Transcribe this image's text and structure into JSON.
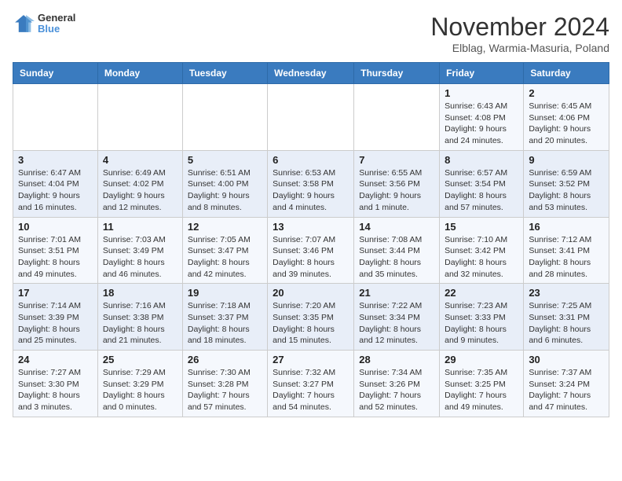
{
  "header": {
    "logo_text_1": "General",
    "logo_text_2": "Blue",
    "month": "November 2024",
    "location": "Elblag, Warmia-Masuria, Poland"
  },
  "days_of_week": [
    "Sunday",
    "Monday",
    "Tuesday",
    "Wednesday",
    "Thursday",
    "Friday",
    "Saturday"
  ],
  "weeks": [
    [
      {
        "day": "",
        "info": ""
      },
      {
        "day": "",
        "info": ""
      },
      {
        "day": "",
        "info": ""
      },
      {
        "day": "",
        "info": ""
      },
      {
        "day": "",
        "info": ""
      },
      {
        "day": "1",
        "info": "Sunrise: 6:43 AM\nSunset: 4:08 PM\nDaylight: 9 hours and 24 minutes."
      },
      {
        "day": "2",
        "info": "Sunrise: 6:45 AM\nSunset: 4:06 PM\nDaylight: 9 hours and 20 minutes."
      }
    ],
    [
      {
        "day": "3",
        "info": "Sunrise: 6:47 AM\nSunset: 4:04 PM\nDaylight: 9 hours and 16 minutes."
      },
      {
        "day": "4",
        "info": "Sunrise: 6:49 AM\nSunset: 4:02 PM\nDaylight: 9 hours and 12 minutes."
      },
      {
        "day": "5",
        "info": "Sunrise: 6:51 AM\nSunset: 4:00 PM\nDaylight: 9 hours and 8 minutes."
      },
      {
        "day": "6",
        "info": "Sunrise: 6:53 AM\nSunset: 3:58 PM\nDaylight: 9 hours and 4 minutes."
      },
      {
        "day": "7",
        "info": "Sunrise: 6:55 AM\nSunset: 3:56 PM\nDaylight: 9 hours and 1 minute."
      },
      {
        "day": "8",
        "info": "Sunrise: 6:57 AM\nSunset: 3:54 PM\nDaylight: 8 hours and 57 minutes."
      },
      {
        "day": "9",
        "info": "Sunrise: 6:59 AM\nSunset: 3:52 PM\nDaylight: 8 hours and 53 minutes."
      }
    ],
    [
      {
        "day": "10",
        "info": "Sunrise: 7:01 AM\nSunset: 3:51 PM\nDaylight: 8 hours and 49 minutes."
      },
      {
        "day": "11",
        "info": "Sunrise: 7:03 AM\nSunset: 3:49 PM\nDaylight: 8 hours and 46 minutes."
      },
      {
        "day": "12",
        "info": "Sunrise: 7:05 AM\nSunset: 3:47 PM\nDaylight: 8 hours and 42 minutes."
      },
      {
        "day": "13",
        "info": "Sunrise: 7:07 AM\nSunset: 3:46 PM\nDaylight: 8 hours and 39 minutes."
      },
      {
        "day": "14",
        "info": "Sunrise: 7:08 AM\nSunset: 3:44 PM\nDaylight: 8 hours and 35 minutes."
      },
      {
        "day": "15",
        "info": "Sunrise: 7:10 AM\nSunset: 3:42 PM\nDaylight: 8 hours and 32 minutes."
      },
      {
        "day": "16",
        "info": "Sunrise: 7:12 AM\nSunset: 3:41 PM\nDaylight: 8 hours and 28 minutes."
      }
    ],
    [
      {
        "day": "17",
        "info": "Sunrise: 7:14 AM\nSunset: 3:39 PM\nDaylight: 8 hours and 25 minutes."
      },
      {
        "day": "18",
        "info": "Sunrise: 7:16 AM\nSunset: 3:38 PM\nDaylight: 8 hours and 21 minutes."
      },
      {
        "day": "19",
        "info": "Sunrise: 7:18 AM\nSunset: 3:37 PM\nDaylight: 8 hours and 18 minutes."
      },
      {
        "day": "20",
        "info": "Sunrise: 7:20 AM\nSunset: 3:35 PM\nDaylight: 8 hours and 15 minutes."
      },
      {
        "day": "21",
        "info": "Sunrise: 7:22 AM\nSunset: 3:34 PM\nDaylight: 8 hours and 12 minutes."
      },
      {
        "day": "22",
        "info": "Sunrise: 7:23 AM\nSunset: 3:33 PM\nDaylight: 8 hours and 9 minutes."
      },
      {
        "day": "23",
        "info": "Sunrise: 7:25 AM\nSunset: 3:31 PM\nDaylight: 8 hours and 6 minutes."
      }
    ],
    [
      {
        "day": "24",
        "info": "Sunrise: 7:27 AM\nSunset: 3:30 PM\nDaylight: 8 hours and 3 minutes."
      },
      {
        "day": "25",
        "info": "Sunrise: 7:29 AM\nSunset: 3:29 PM\nDaylight: 8 hours and 0 minutes."
      },
      {
        "day": "26",
        "info": "Sunrise: 7:30 AM\nSunset: 3:28 PM\nDaylight: 7 hours and 57 minutes."
      },
      {
        "day": "27",
        "info": "Sunrise: 7:32 AM\nSunset: 3:27 PM\nDaylight: 7 hours and 54 minutes."
      },
      {
        "day": "28",
        "info": "Sunrise: 7:34 AM\nSunset: 3:26 PM\nDaylight: 7 hours and 52 minutes."
      },
      {
        "day": "29",
        "info": "Sunrise: 7:35 AM\nSunset: 3:25 PM\nDaylight: 7 hours and 49 minutes."
      },
      {
        "day": "30",
        "info": "Sunrise: 7:37 AM\nSunset: 3:24 PM\nDaylight: 7 hours and 47 minutes."
      }
    ]
  ]
}
